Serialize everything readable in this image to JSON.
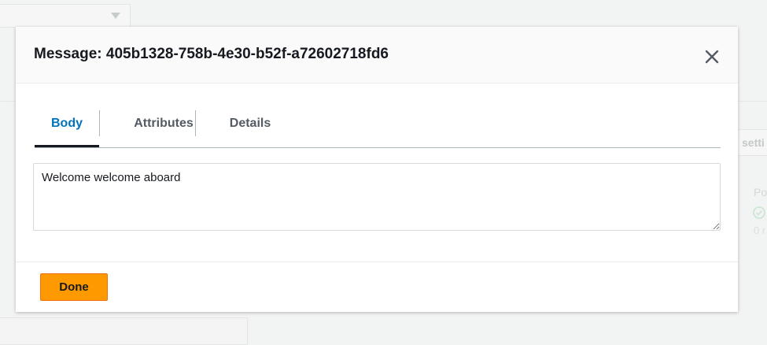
{
  "background": {
    "settings_button_label": "setti",
    "policy_label": "Po",
    "count_text": "0 r"
  },
  "modal": {
    "title": "Message: 405b1328-758b-4e30-b52f-a72602718fd6",
    "close_icon": "close-icon",
    "tabs": [
      {
        "label": "Body",
        "active": true
      },
      {
        "label": "Attributes",
        "active": false
      },
      {
        "label": "Details",
        "active": false
      }
    ],
    "body_text": "Welcome welcome aboard",
    "done_label": "Done"
  },
  "colors": {
    "accent_tab": "#0073bb",
    "primary_button": "#ff9900",
    "text_dark": "#16191f"
  }
}
